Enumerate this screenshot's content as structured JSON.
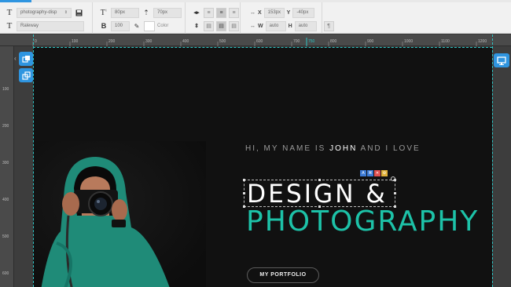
{
  "toolbar": {
    "style_select_value": "photography-disp",
    "font_select_value": "Raleway",
    "font_size_value": "80px",
    "line_height_value": "70px",
    "font_weight_value": "100",
    "color_label": "Color",
    "x_value": "153px",
    "y_value": "-40px",
    "width_value": "auto",
    "height_value": "auto",
    "x_label": "X",
    "y_label": "Y",
    "w_label": "W",
    "h_label": "H"
  },
  "ruler": {
    "top_ticks": [
      "0",
      "100",
      "200",
      "300",
      "400",
      "500",
      "600",
      "700",
      "750",
      "800",
      "900",
      "1000",
      "1100",
      "1200"
    ],
    "highlight_tick": "750",
    "left_ticks": [
      "100",
      "200",
      "300",
      "400",
      "500",
      "600"
    ]
  },
  "hero": {
    "intro_prefix": "HI, MY NAME IS",
    "intro_name": "JOHN",
    "intro_suffix": "AND I LOVE",
    "headline": "DESIGN &",
    "subheadline": "PHOTOGRAPHY",
    "button_label": "MY PORTFOLIO"
  },
  "colors": {
    "accent_blue": "#2f95e0",
    "teal": "#1dc2a8",
    "guide": "#2ec4c4",
    "page_bg": "#111111"
  },
  "icons": [
    "font-style-icon",
    "save-icon",
    "font-size-icon",
    "line-height-icon",
    "align-left-icon",
    "align-center-icon",
    "align-right-icon",
    "bold-icon",
    "pen-icon",
    "vertical-resize-icon",
    "paragraph-icon",
    "layers-icon",
    "duplicate-icon",
    "desktop-icon"
  ]
}
